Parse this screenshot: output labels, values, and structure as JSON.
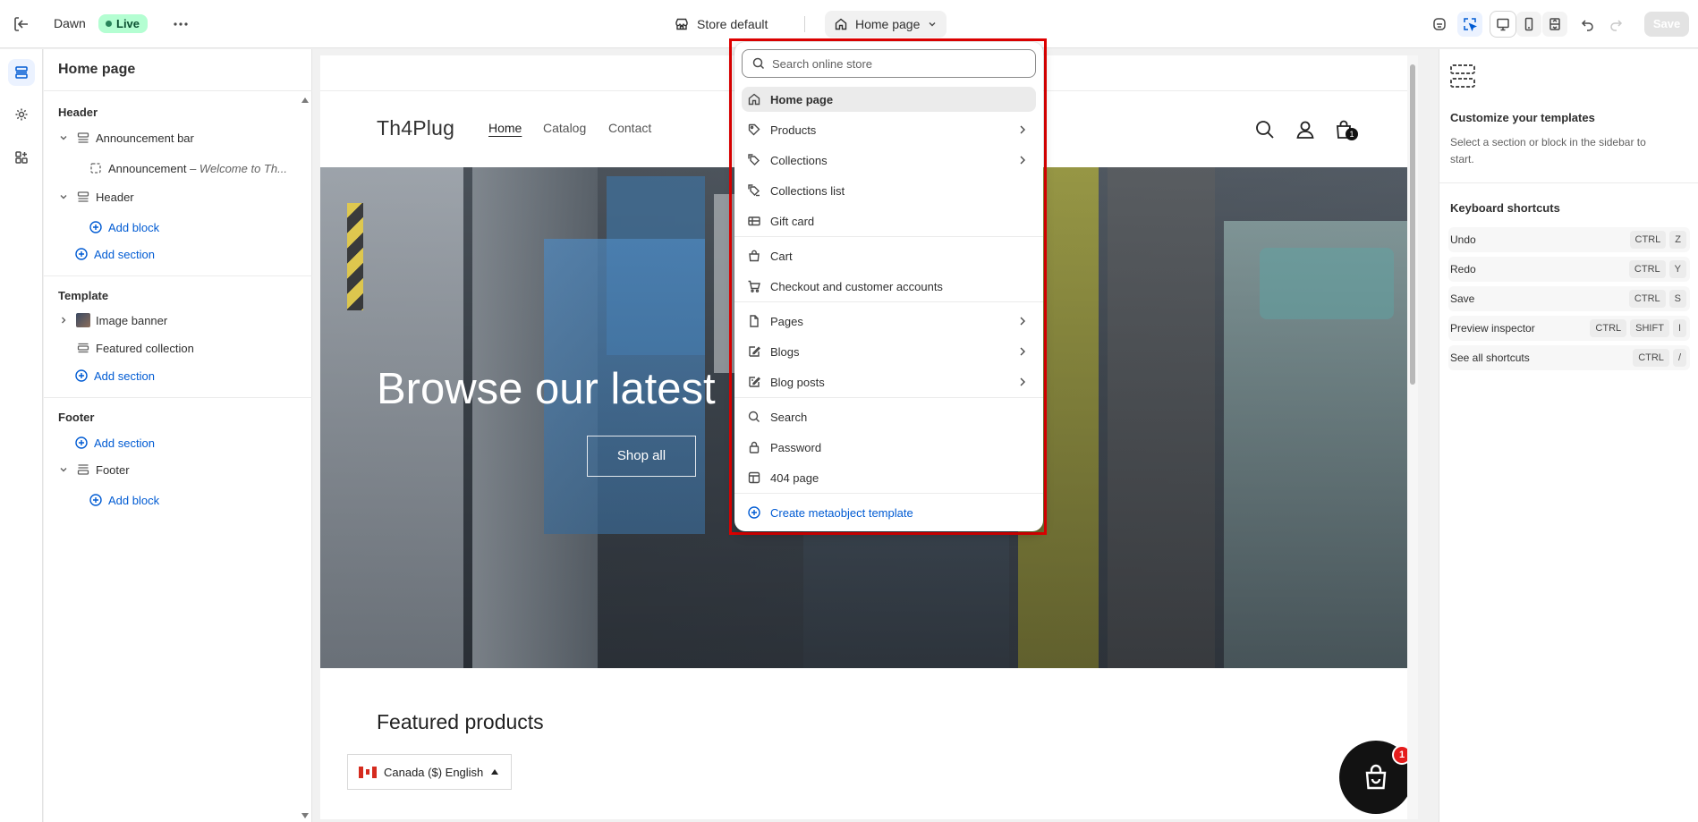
{
  "topbar": {
    "theme_name": "Dawn",
    "status": "Live",
    "store_label": "Store default",
    "page_label": "Home page",
    "save_label": "Save"
  },
  "sidebar": {
    "title": "Home page",
    "groups": [
      {
        "label": "Header",
        "items": [
          {
            "label": "Announcement bar"
          },
          {
            "label": "Announcement",
            "detail": "– Welcome to Th..."
          },
          {
            "label": "Header"
          },
          {
            "add": "Add block"
          },
          {
            "add": "Add section"
          }
        ]
      },
      {
        "label": "Template",
        "items": [
          {
            "label": "Image banner"
          },
          {
            "label": "Featured collection"
          },
          {
            "add": "Add section"
          }
        ]
      },
      {
        "label": "Footer",
        "items": [
          {
            "add": "Add section"
          },
          {
            "label": "Footer"
          },
          {
            "add": "Add block"
          }
        ]
      }
    ]
  },
  "preview": {
    "logo": "Th4Plug",
    "nav": [
      "Home",
      "Catalog",
      "Contact"
    ],
    "cart_count": "1",
    "banner_heading": "Browse our latest",
    "banner_button": "Shop all",
    "featured_heading": "Featured products",
    "locale": "Canada ($) English",
    "bag_count": "1"
  },
  "right_panel": {
    "heading": "Customize your templates",
    "text": "Select a section or block in the sidebar to start.",
    "shortcuts_heading": "Keyboard shortcuts",
    "shortcuts": [
      {
        "label": "Undo",
        "keys": [
          "CTRL",
          "Z"
        ]
      },
      {
        "label": "Redo",
        "keys": [
          "CTRL",
          "Y"
        ]
      },
      {
        "label": "Save",
        "keys": [
          "CTRL",
          "S"
        ]
      },
      {
        "label": "Preview inspector",
        "keys": [
          "CTRL",
          "SHIFT",
          "I"
        ]
      },
      {
        "label": "See all shortcuts",
        "keys": [
          "CTRL",
          "/"
        ]
      }
    ]
  },
  "dropdown": {
    "search_placeholder": "Search online store",
    "items": [
      {
        "label": "Home page",
        "icon": "home-icon",
        "selected": true
      },
      {
        "label": "Products",
        "icon": "tag-icon",
        "submenu": true
      },
      {
        "label": "Collections",
        "icon": "tags-icon",
        "submenu": true
      },
      {
        "label": "Collections list",
        "icon": "tags-list-icon"
      },
      {
        "label": "Gift card",
        "icon": "gift-card-icon"
      },
      {
        "label": "Cart",
        "icon": "bag-icon"
      },
      {
        "label": "Checkout and customer accounts",
        "icon": "cart-icon"
      },
      {
        "label": "Pages",
        "icon": "page-icon",
        "submenu": true
      },
      {
        "label": "Blogs",
        "icon": "blog-icon",
        "submenu": true
      },
      {
        "label": "Blog posts",
        "icon": "blog-post-icon",
        "submenu": true
      },
      {
        "label": "Search",
        "icon": "search-icon"
      },
      {
        "label": "Password",
        "icon": "lock-icon"
      },
      {
        "label": "404 page",
        "icon": "layout-icon"
      },
      {
        "label": "Create metaobject template",
        "icon": "plus-circle-icon"
      }
    ]
  },
  "colors": {
    "accent": "#005bd3",
    "live_bg": "#b4fed2",
    "highlight_outline": "#e00000"
  }
}
